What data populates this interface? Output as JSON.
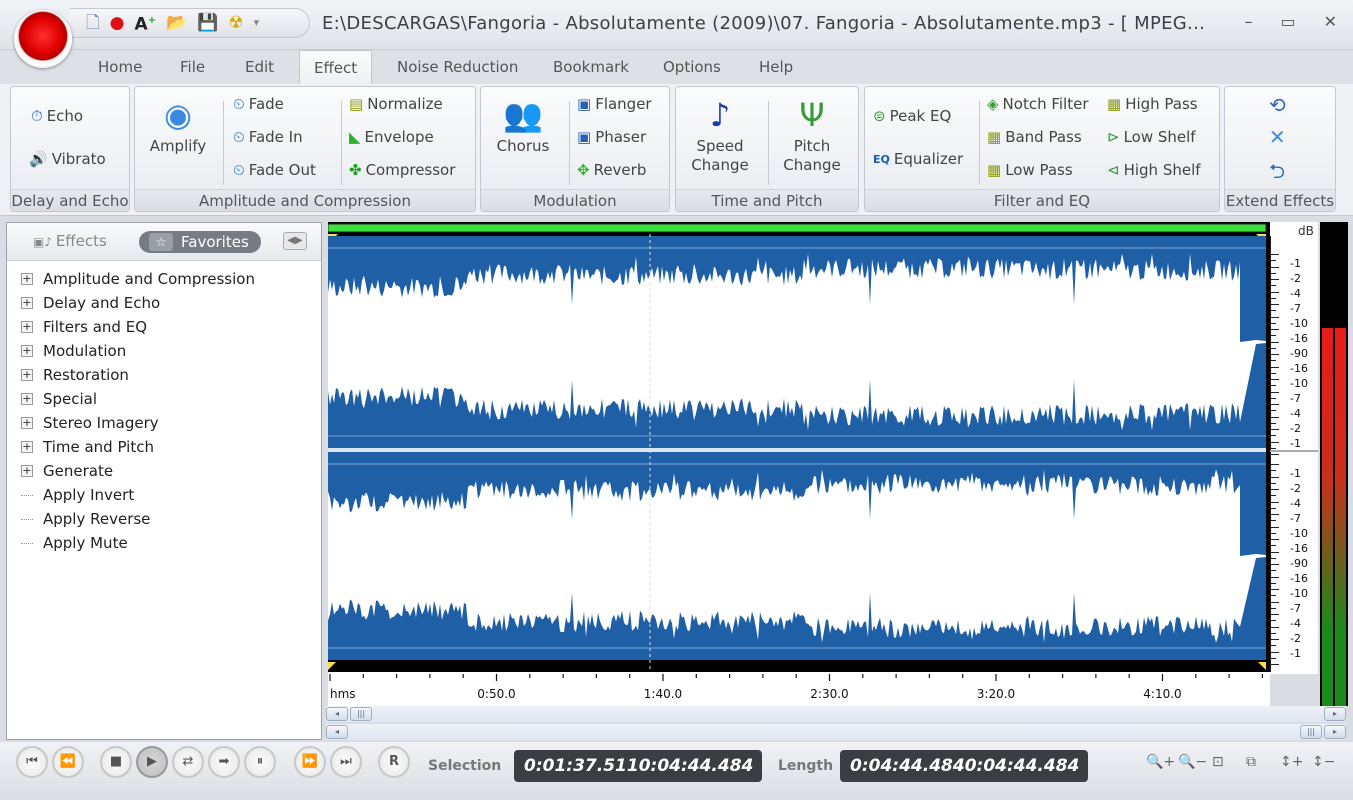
{
  "window": {
    "title": "E:\\DESCARGAS\\Fangoria - Absolutamente (2009)\\07. Fangoria - Absolutamente.mp3 - [ MPEG...",
    "minimize": "–",
    "maximize": "▭",
    "close": "✕"
  },
  "quick_access": [
    {
      "name": "new-file-icon",
      "glyph": "🗋"
    },
    {
      "name": "record-icon",
      "glyph": "●"
    },
    {
      "name": "add-text-icon",
      "glyph": "A+"
    },
    {
      "name": "open-folder-icon",
      "glyph": "📂"
    },
    {
      "name": "save-icon",
      "glyph": "💾"
    },
    {
      "name": "radioactive-icon",
      "glyph": "☢"
    },
    {
      "name": "dropdown-icon",
      "glyph": "▾"
    }
  ],
  "tabs": [
    "Home",
    "File",
    "Edit",
    "Effect",
    "Noise Reduction",
    "Bookmark",
    "Options",
    "Help"
  ],
  "active_tab": "Effect",
  "ribbon": {
    "delay_echo": {
      "label": "Delay and Echo",
      "echo": "Echo",
      "vibrato": "Vibrato"
    },
    "amplitude": {
      "label": "Amplitude and Compression",
      "amplify": "Amplify",
      "fade": "Fade",
      "fade_in": "Fade In",
      "fade_out": "Fade Out",
      "normalize": "Normalize",
      "envelope": "Envelope",
      "compressor": "Compressor"
    },
    "modulation": {
      "label": "Modulation",
      "chorus": "Chorus",
      "flanger": "Flanger",
      "phaser": "Phaser",
      "reverb": "Reverb"
    },
    "time_pitch": {
      "label": "Time and Pitch",
      "speed_1": "Speed",
      "speed_2": "Change",
      "pitch_1": "Pitch",
      "pitch_2": "Change"
    },
    "filter_eq": {
      "label": "Filter and EQ",
      "peak_eq": "Peak EQ",
      "equalizer": "Equalizer",
      "notch": "Notch Filter",
      "band_pass": "Band Pass",
      "low_pass": "Low Pass",
      "high_pass": "High Pass",
      "low_shelf": "Low Shelf",
      "high_shelf": "High Shelf"
    },
    "extend": {
      "label": "Extend Effects"
    }
  },
  "panel": {
    "tab_effects": "Effects",
    "tab_favorites": "Favorites",
    "tree": [
      {
        "label": "Amplitude and Compression",
        "expandable": true
      },
      {
        "label": "Delay and Echo",
        "expandable": true
      },
      {
        "label": "Filters and EQ",
        "expandable": true
      },
      {
        "label": "Modulation",
        "expandable": true
      },
      {
        "label": "Restoration",
        "expandable": true
      },
      {
        "label": "Special",
        "expandable": true
      },
      {
        "label": "Stereo Imagery",
        "expandable": true
      },
      {
        "label": "Time and Pitch",
        "expandable": true
      },
      {
        "label": "Generate",
        "expandable": true
      },
      {
        "label": "Apply Invert",
        "expandable": false
      },
      {
        "label": "Apply Reverse",
        "expandable": false
      },
      {
        "label": "Apply Mute",
        "expandable": false
      }
    ]
  },
  "waveform": {
    "cursor_time": "1:40.0",
    "colors": {
      "background": "#1f5fa6",
      "wave": "#ffffff",
      "overview": "#3ee03e"
    }
  },
  "db_scale": {
    "unit": "dB",
    "ch1": [
      "-1",
      "-2",
      "-4",
      "-7",
      "-10",
      "-16",
      "-90",
      "-16",
      "-10",
      "-7",
      "-4",
      "-2",
      "-1"
    ],
    "ch2": [
      "-1",
      "-2",
      "-4",
      "-7",
      "-10",
      "-16",
      "-90",
      "-16",
      "-10",
      "-7",
      "-4",
      "-2",
      "-1"
    ]
  },
  "timeline": {
    "unit": "hms",
    "labels": [
      "0:50.0",
      "1:40.0",
      "2:30.0",
      "3:20.0",
      "4:10.0"
    ]
  },
  "meter": {
    "level_ch1": 0.78,
    "level_ch2": 0.78
  },
  "transport": [
    {
      "name": "go-to-start-button",
      "glyph": "⏮"
    },
    {
      "name": "rewind-button",
      "glyph": "⏪"
    },
    {
      "name": "stop-button",
      "glyph": "■"
    },
    {
      "name": "play-button",
      "glyph": "▶"
    },
    {
      "name": "loop-button",
      "glyph": "⇄"
    },
    {
      "name": "play-to-end-button",
      "glyph": "➡"
    },
    {
      "name": "pause-button",
      "glyph": "⏸"
    },
    {
      "name": "fast-forward-button",
      "glyph": "⏩"
    },
    {
      "name": "go-to-end-button",
      "glyph": "⏭"
    },
    {
      "name": "record-button",
      "glyph": "R"
    }
  ],
  "selection": {
    "label": "Selection",
    "start": "0:01:37.511",
    "end": "0:04:44.484"
  },
  "length": {
    "label": "Length",
    "start": "0:04:44.484",
    "end": "0:04:44.484"
  },
  "zoom_tools": [
    {
      "name": "zoom-in-icon",
      "glyph": "🔍+"
    },
    {
      "name": "zoom-out-icon",
      "glyph": "🔍−"
    },
    {
      "name": "zoom-selection-icon",
      "glyph": "⊡"
    },
    {
      "name": "zoom-all-icon",
      "glyph": "⧉"
    },
    {
      "name": "zoom-in-vertical-icon",
      "glyph": "↕+"
    },
    {
      "name": "zoom-out-vertical-icon",
      "glyph": "↕−"
    }
  ]
}
